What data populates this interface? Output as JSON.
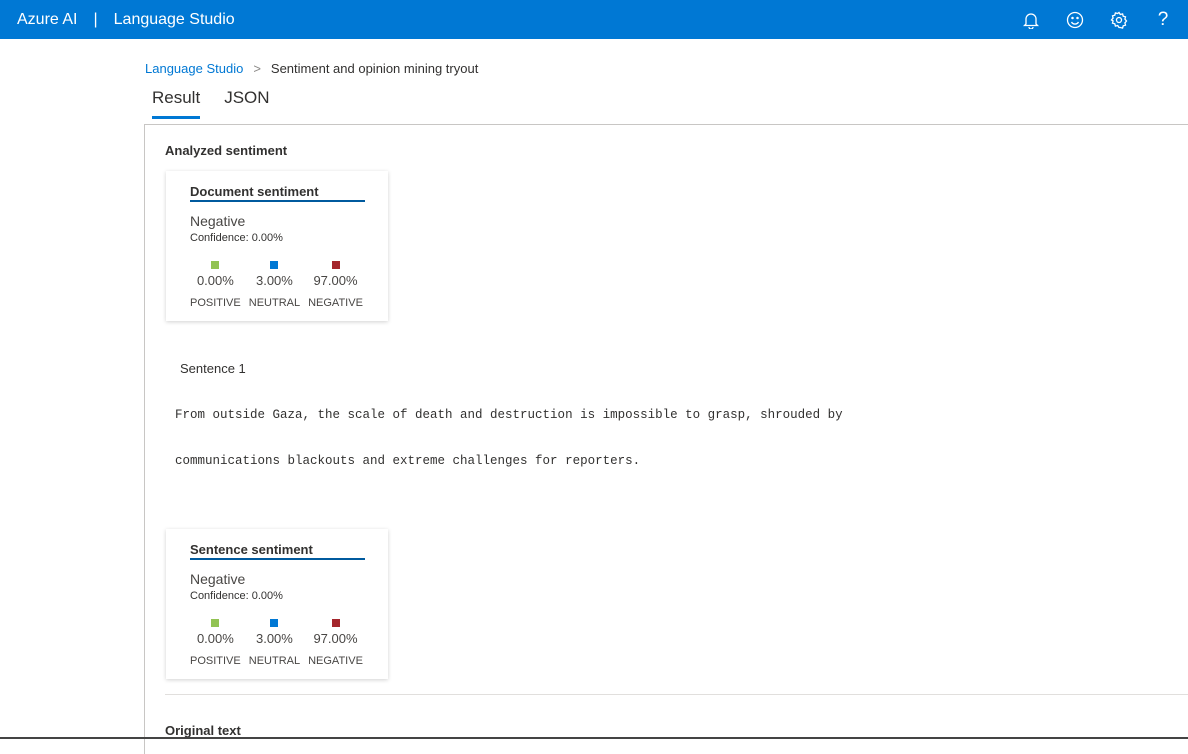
{
  "topbar": {
    "brand": "Azure AI",
    "separator": "|",
    "product": "Language Studio",
    "icons": [
      "bell-icon",
      "smiley-icon",
      "gear-icon",
      "help-icon"
    ]
  },
  "breadcrumb": {
    "root": "Language Studio",
    "current": "Sentiment and opinion mining tryout"
  },
  "tabs": [
    {
      "label": "Result",
      "active": true
    },
    {
      "label": "JSON",
      "active": false
    }
  ],
  "colors": {
    "accent": "#0078d4",
    "positive": "#92c353",
    "neutral": "#0078d4",
    "negative": "#a4262c"
  },
  "analyzed_heading": "Analyzed sentiment",
  "document": {
    "title": "Document sentiment",
    "label": "Negative",
    "confidence": "Confidence: 0.00%",
    "scores": [
      {
        "value": "0.00%",
        "name": "POSITIVE"
      },
      {
        "value": "3.00%",
        "name": "NEUTRAL"
      },
      {
        "value": "97.00%",
        "name": "NEGATIVE"
      }
    ]
  },
  "sentence": {
    "heading": "Sentence 1",
    "lines": [
      "From outside Gaza, the scale of death and destruction is impossible to grasp, shrouded by",
      "communications blackouts and extreme challenges for reporters."
    ],
    "title": "Sentence sentiment",
    "label": "Negative",
    "confidence": "Confidence: 0.00%",
    "scores": [
      {
        "value": "0.00%",
        "name": "POSITIVE"
      },
      {
        "value": "3.00%",
        "name": "NEUTRAL"
      },
      {
        "value": "97.00%",
        "name": "NEGATIVE"
      }
    ]
  },
  "original_heading": "Original text"
}
